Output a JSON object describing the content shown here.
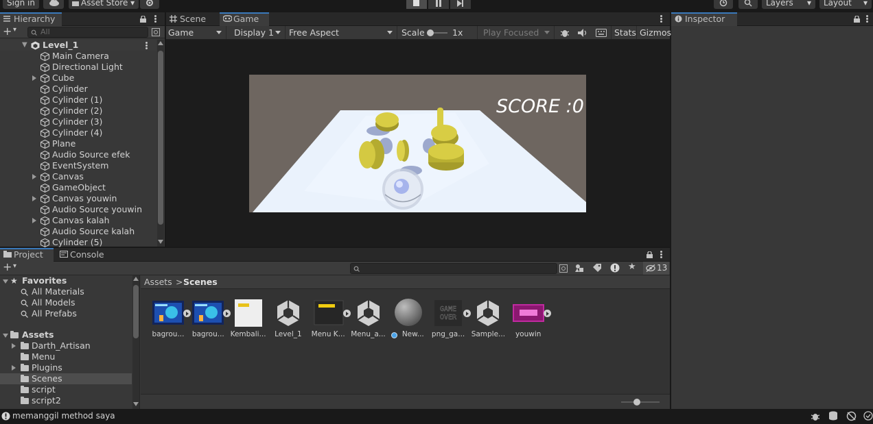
{
  "toolbar": {
    "sign_in": "Sign in",
    "asset_store": "Asset Store",
    "layers": "Layers",
    "layout": "Layout"
  },
  "hierarchy": {
    "tab": "Hierarchy",
    "search_placeholder": "All",
    "scene": "Level_1",
    "items": [
      {
        "label": "Main Camera",
        "expandable": false
      },
      {
        "label": "Directional Light",
        "expandable": false
      },
      {
        "label": "Cube",
        "expandable": true
      },
      {
        "label": "Cylinder",
        "expandable": false
      },
      {
        "label": "Cylinder (1)",
        "expandable": false
      },
      {
        "label": "Cylinder (2)",
        "expandable": false
      },
      {
        "label": "Cylinder (3)",
        "expandable": false
      },
      {
        "label": "Cylinder (4)",
        "expandable": false
      },
      {
        "label": "Plane",
        "expandable": false
      },
      {
        "label": "Audio Source efek",
        "expandable": false
      },
      {
        "label": "EventSystem",
        "expandable": false
      },
      {
        "label": "Canvas",
        "expandable": true
      },
      {
        "label": "GameObject",
        "expandable": false
      },
      {
        "label": "Canvas youwin",
        "expandable": true
      },
      {
        "label": "Audio Source youwin",
        "expandable": false
      },
      {
        "label": "Canvas kalah",
        "expandable": true
      },
      {
        "label": "Audio Source kalah",
        "expandable": false
      },
      {
        "label": "Cylinder (5)",
        "expandable": false
      }
    ]
  },
  "game_view": {
    "tabs": [
      "Scene",
      "Game"
    ],
    "active_tab": "Game",
    "mode": "Game",
    "display": "Display 1",
    "aspect": "Free Aspect",
    "scale_label": "Scale",
    "scale_value": "1x",
    "play_focused": "Play Focused",
    "stats": "Stats",
    "gizmos": "Gizmos",
    "score_text": "SCORE :0",
    "colors": {
      "sky": "#6e6660",
      "floor": "#eaf2fc",
      "coin": "#cfc43a"
    }
  },
  "inspector": {
    "tab": "Inspector"
  },
  "project": {
    "tabs": [
      "Project",
      "Console"
    ],
    "active_tab": "Project",
    "hidden_count": "13",
    "favorites": {
      "label": "Favorites",
      "items": [
        "All Materials",
        "All Models",
        "All Prefabs"
      ]
    },
    "assets": {
      "label": "Assets",
      "folders": [
        "Darth_Artisan",
        "Menu",
        "Plugins",
        "Scenes",
        "script",
        "script2"
      ],
      "selected": "Scenes"
    },
    "breadcrumb": {
      "root": "Assets",
      "current": "Scenes"
    },
    "files": [
      {
        "name": "bagrou...",
        "kind": "image-blue",
        "badge": true
      },
      {
        "name": "bagrou...",
        "kind": "image-blue",
        "badge": true
      },
      {
        "name": "Kembali...",
        "kind": "image-white",
        "badge": false
      },
      {
        "name": "Level_1",
        "kind": "unity-scene",
        "badge": false
      },
      {
        "name": "Menu K...",
        "kind": "prefab-dark",
        "badge": true
      },
      {
        "name": "Menu_a...",
        "kind": "unity-scene",
        "badge": false
      },
      {
        "name": "New...",
        "kind": "material-sphere",
        "badge": false
      },
      {
        "name": "png_ga...",
        "kind": "image-gameover",
        "badge": true
      },
      {
        "name": "Sample...",
        "kind": "unity-scene",
        "badge": false
      },
      {
        "name": "youwin",
        "kind": "image-pink",
        "badge": true
      }
    ],
    "gameover_text": "GAME OVER"
  },
  "status": {
    "message": "memanggil method saya"
  }
}
